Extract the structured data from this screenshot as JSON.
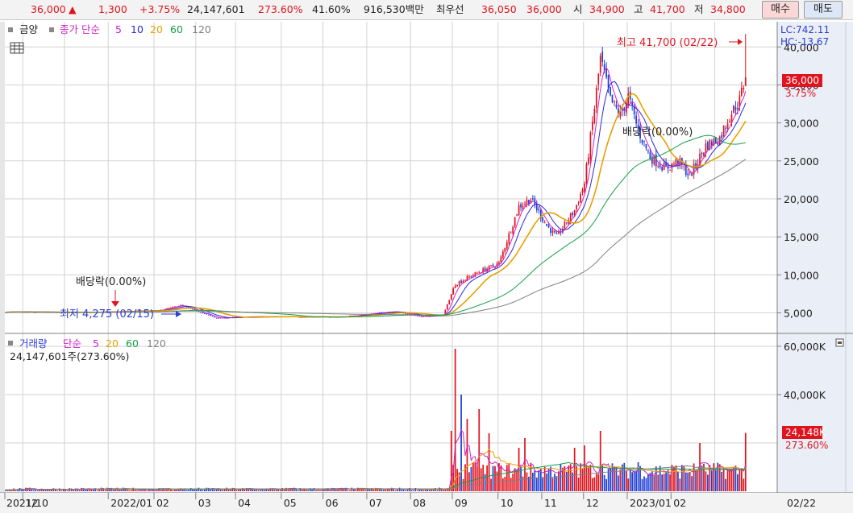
{
  "quote_bar": {
    "price": "36,000",
    "change_arrow": "▲",
    "change": "1,300",
    "change_pct": "+3.75%",
    "volume": "24,147,601",
    "volume_ratio": "273.60%",
    "turnover_ratio": "41.60%",
    "trade_value": "916,530백만",
    "best_ask_label": "최우선",
    "best_ask": "36,050",
    "best_bid": "36,000",
    "open_label": "시",
    "open": "34,900",
    "high_label": "고",
    "high": "41,700",
    "low_label": "저",
    "low": "34,800",
    "buy_button": "매수",
    "sell_button": "매도"
  },
  "price_panel": {
    "stock_name": "금양",
    "ma_legend_label": "종가 단순",
    "ma_periods": [
      "5",
      "10",
      "20",
      "60",
      "120"
    ],
    "ma_colors": [
      "#d020c8",
      "#2a2ad8",
      "#e8a000",
      "#12a045",
      "#808080"
    ],
    "lc_label": "LC:742.11",
    "hc_label": "HC:-13.67",
    "current_price_label": "36,000",
    "current_change_label": "3.75%",
    "high_annotation": "최고 41,700 (02/22)",
    "low_annotation": "최저 4,275 (02/15)",
    "dividend_annotation_1": "배당락(0.00%)",
    "dividend_annotation_2": "배당락(0.00%)"
  },
  "volume_panel": {
    "title": "거래량",
    "ma_legend_label": "단순",
    "ma_periods": [
      "5",
      "20",
      "60",
      "120"
    ],
    "ma_colors": [
      "#d020c8",
      "#e8a000",
      "#12a045",
      "#808080"
    ],
    "total_label": "24,147,601주(273.60%)",
    "current_label": "24,148K",
    "current_pct": "273.60%"
  },
  "x_axis": {
    "labels": [
      "2021/10",
      "12",
      "2022/01",
      "02",
      "03",
      "04",
      "05",
      "06",
      "07",
      "08",
      "09",
      "10",
      "11",
      "12",
      "2023/01",
      "02"
    ],
    "right_label": "02/22"
  },
  "colors": {
    "up": "#e0141e",
    "down": "#1f3fd6",
    "grid": "#d2d2d2",
    "axis_bg": "#eaeef6"
  },
  "chart_data": [
    {
      "type": "line",
      "title": "금양",
      "ylim": [
        2500,
        43000
      ],
      "yticks": [
        5000,
        10000,
        15000,
        20000,
        25000,
        30000,
        35000,
        40000
      ],
      "ytick_labels": [
        "5,000",
        "10,000",
        "15,000",
        "20,000",
        "25,000",
        "30,000",
        "35,000",
        "40,000"
      ],
      "close_anchors": [
        {
          "date": "2021-09-20",
          "close": 5100
        },
        {
          "date": "2021-11-15",
          "close": 5050
        },
        {
          "date": "2022-01-05",
          "close": 5300
        },
        {
          "date": "2022-01-20",
          "close": 6000
        },
        {
          "date": "2022-02-15",
          "close": 4300
        },
        {
          "date": "2022-03-15",
          "close": 4500
        },
        {
          "date": "2022-05-15",
          "close": 4450
        },
        {
          "date": "2022-06-20",
          "close": 5200
        },
        {
          "date": "2022-07-10",
          "close": 4500
        },
        {
          "date": "2022-07-25",
          "close": 4700
        },
        {
          "date": "2022-08-02",
          "close": 8800
        },
        {
          "date": "2022-08-20",
          "close": 10500
        },
        {
          "date": "2022-09-01",
          "close": 11500
        },
        {
          "date": "2022-09-15",
          "close": 19000
        },
        {
          "date": "2022-09-25",
          "close": 20000
        },
        {
          "date": "2022-10-05",
          "close": 16500
        },
        {
          "date": "2022-10-12",
          "close": 15000
        },
        {
          "date": "2022-10-25",
          "close": 18500
        },
        {
          "date": "2022-11-01",
          "close": 22000
        },
        {
          "date": "2022-11-08",
          "close": 32000
        },
        {
          "date": "2022-11-11",
          "close": 38500
        },
        {
          "date": "2022-11-18",
          "close": 33000
        },
        {
          "date": "2022-11-25",
          "close": 31000
        },
        {
          "date": "2022-12-01",
          "close": 33500
        },
        {
          "date": "2022-12-08",
          "close": 29000
        },
        {
          "date": "2022-12-18",
          "close": 25500
        },
        {
          "date": "2022-12-28",
          "close": 24000
        },
        {
          "date": "2023-01-05",
          "close": 25000
        },
        {
          "date": "2023-01-15",
          "close": 23000
        },
        {
          "date": "2023-01-25",
          "close": 27000
        },
        {
          "date": "2023-02-05",
          "close": 28000
        },
        {
          "date": "2023-02-12",
          "close": 31000
        },
        {
          "date": "2023-02-18",
          "close": 33000
        },
        {
          "date": "2023-02-22",
          "close": 36000
        }
      ],
      "last": {
        "date": "2023-02-22",
        "open": 34900,
        "high": 41700,
        "low": 34800,
        "close": 36000,
        "change_pct": 3.75
      },
      "period_high": {
        "date": "2023-02-22",
        "value": 41700
      },
      "period_low": {
        "date": "2022-02-15",
        "value": 4275
      },
      "moving_averages": [
        "5",
        "10",
        "20",
        "60",
        "120"
      ]
    },
    {
      "type": "bar",
      "title": "거래량",
      "ylim": [
        0,
        64000000
      ],
      "yticks": [
        20000000,
        40000000,
        60000000
      ],
      "ytick_labels": [
        "40,000K",
        "60,000K"
      ],
      "volume_spikes": [
        {
          "date": "2022-07-29",
          "volume": 25000000
        },
        {
          "date": "2022-08-02",
          "volume": 59000000
        },
        {
          "date": "2022-08-05",
          "volume": 40000000
        },
        {
          "date": "2022-08-10",
          "volume": 30000000
        },
        {
          "date": "2022-08-18",
          "volume": 34000000
        },
        {
          "date": "2022-08-25",
          "volume": 24000000
        },
        {
          "date": "2022-09-15",
          "volume": 18000000
        },
        {
          "date": "2022-09-20",
          "volume": 22000000
        },
        {
          "date": "2022-10-25",
          "volume": 18000000
        },
        {
          "date": "2022-11-01",
          "volume": 19000000
        },
        {
          "date": "2022-11-11",
          "volume": 25000000
        },
        {
          "date": "2022-12-08",
          "volume": 12000000
        },
        {
          "date": "2023-01-20",
          "volume": 20000000
        },
        {
          "date": "2023-02-22",
          "volume": 24147601
        }
      ],
      "last_volume": 24147601,
      "moving_averages": [
        "5",
        "20",
        "60",
        "120"
      ]
    }
  ]
}
